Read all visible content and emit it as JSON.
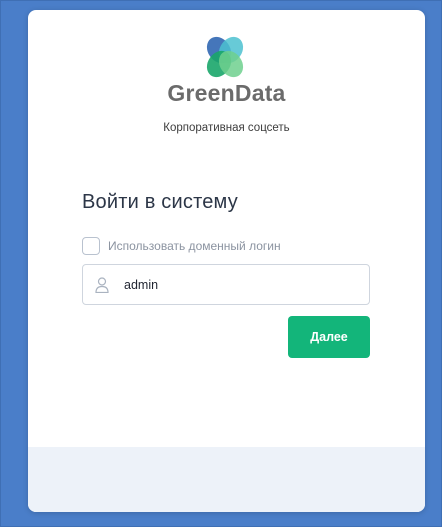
{
  "brand": {
    "name": "GreenData",
    "tagline": "Корпоративная соцсеть",
    "logo_icon": "greendata-logo-icon"
  },
  "login": {
    "title": "Войти в систему",
    "domain_login_label": "Использовать доменный логин",
    "domain_login_checked": false,
    "username_value": "admin",
    "user_icon": "user-icon",
    "next_label": "Далее"
  },
  "colors": {
    "page_background": "#4a7ec9",
    "card_background": "#ffffff",
    "footer_background": "#edf2f9",
    "accent": "#13b57a",
    "heading_text": "#2c3647"
  }
}
